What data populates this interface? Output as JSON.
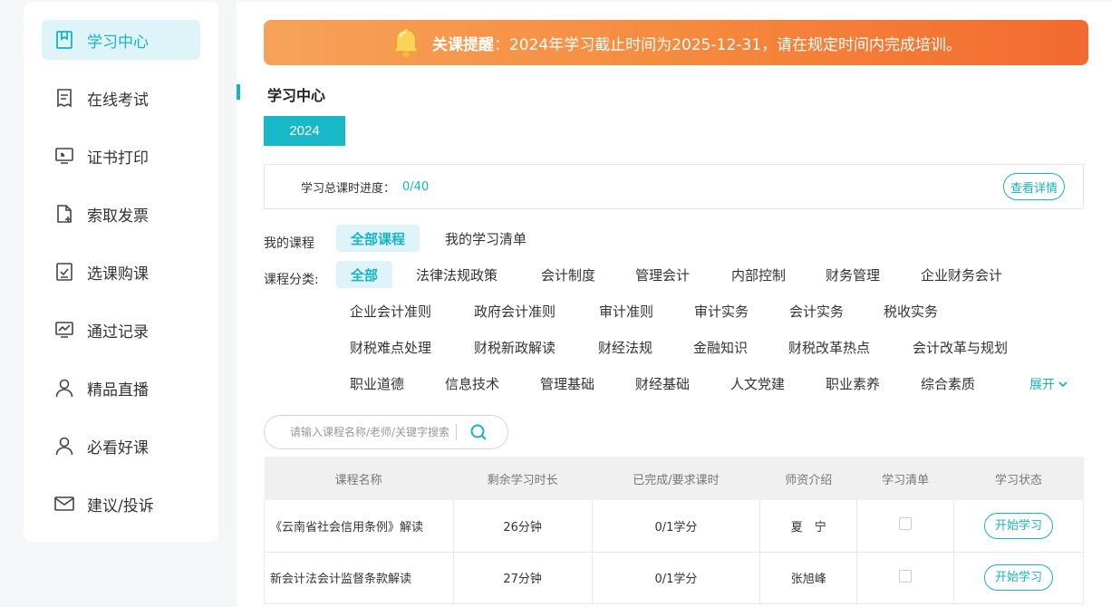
{
  "sidebar": {
    "items": [
      {
        "label": "学习中心",
        "icon": "bookmark-icon"
      },
      {
        "label": "在线考试",
        "icon": "document-icon"
      },
      {
        "label": "证书打印",
        "icon": "certificate-icon"
      },
      {
        "label": "索取发票",
        "icon": "file-add-icon"
      },
      {
        "label": "选课购课",
        "icon": "checklist-icon"
      },
      {
        "label": "通过记录",
        "icon": "chart-icon"
      },
      {
        "label": "精品直播",
        "icon": "user-icon"
      },
      {
        "label": "必看好课",
        "icon": "user-icon"
      },
      {
        "label": "建议/投诉",
        "icon": "mail-icon"
      }
    ]
  },
  "banner": {
    "prefix": "关课提醒",
    "text": "：2024年学习截止时间为2025-12-31，请在规定时间内完成培训。"
  },
  "section_title": "学习中心",
  "year_tab": "2024",
  "progress": {
    "label": "学习总课时进度：",
    "value": "0/40",
    "detail_button": "查看详情"
  },
  "my_courses": {
    "label": "我的课程",
    "tabs": [
      "全部课程",
      "我的学习清单"
    ]
  },
  "category": {
    "label": "课程分类:",
    "rows": [
      [
        "全部",
        "法律法规政策",
        "会计制度",
        "管理会计",
        "内部控制",
        "财务管理",
        "企业财务会计"
      ],
      [
        "企业会计准则",
        "政府会计准则",
        "审计准则",
        "审计实务",
        "会计实务",
        "税收实务"
      ],
      [
        "财税难点处理",
        "财税新政解读",
        "财经法规",
        "金融知识",
        "财税改革热点",
        "会计改革与规划"
      ],
      [
        "职业道德",
        "信息技术",
        "管理基础",
        "财经基础",
        "人文党建",
        "职业素养",
        "综合素质"
      ]
    ],
    "expand": "展开"
  },
  "search": {
    "placeholder": "请输入课程名称/老师/关键字搜索"
  },
  "table": {
    "headers": [
      "课程名称",
      "剩余学习时长",
      "已完成/要求课时",
      "师资介绍",
      "学习清单",
      "学习状态"
    ],
    "rows": [
      {
        "name": "《云南省社会信用条例》解读",
        "remaining": "26分钟",
        "credit": "0/1学分",
        "teacher": "夏　宁",
        "action": "开始学习"
      },
      {
        "name": "新会计法会计监督条款解读",
        "remaining": "27分钟",
        "credit": "0/1学分",
        "teacher": "张旭峰",
        "action": "开始学习"
      }
    ]
  },
  "colors": {
    "accent": "#17b3c6",
    "banner_start": "#f6a25a",
    "banner_end": "#f26a2f"
  }
}
